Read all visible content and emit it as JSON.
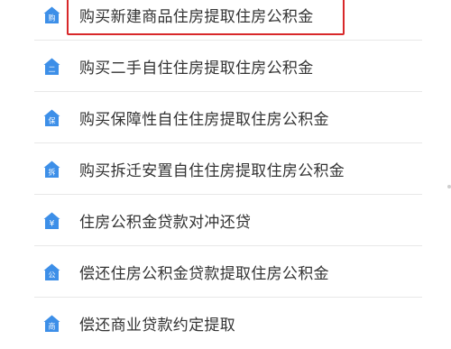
{
  "colors": {
    "icon_blue": "#3d8fe8",
    "highlight_red": "#d8282a",
    "text": "#333333",
    "divider": "#e8e8e8"
  },
  "items": [
    {
      "label": "购买新建商品住房提取住房公积金",
      "icon_char": "购",
      "icon": "house-gou-icon"
    },
    {
      "label": "购买二手自住住房提取住房公积金",
      "icon_char": "二",
      "icon": "house-er-icon"
    },
    {
      "label": "购买保障性自住住房提取住房公积金",
      "icon_char": "保",
      "icon": "house-bao-icon"
    },
    {
      "label": "购买拆迁安置自住住房提取住房公积金",
      "icon_char": "拆",
      "icon": "house-chai-icon"
    },
    {
      "label": "住房公积金贷款对冲还贷",
      "icon_char": "¥",
      "icon": "house-yen-icon"
    },
    {
      "label": "偿还住房公积金贷款提取住房公积金",
      "icon_char": "公",
      "icon": "house-gong-icon"
    },
    {
      "label": "偿还商业贷款约定提取",
      "icon_char": "商",
      "icon": "house-shang-icon"
    }
  ]
}
